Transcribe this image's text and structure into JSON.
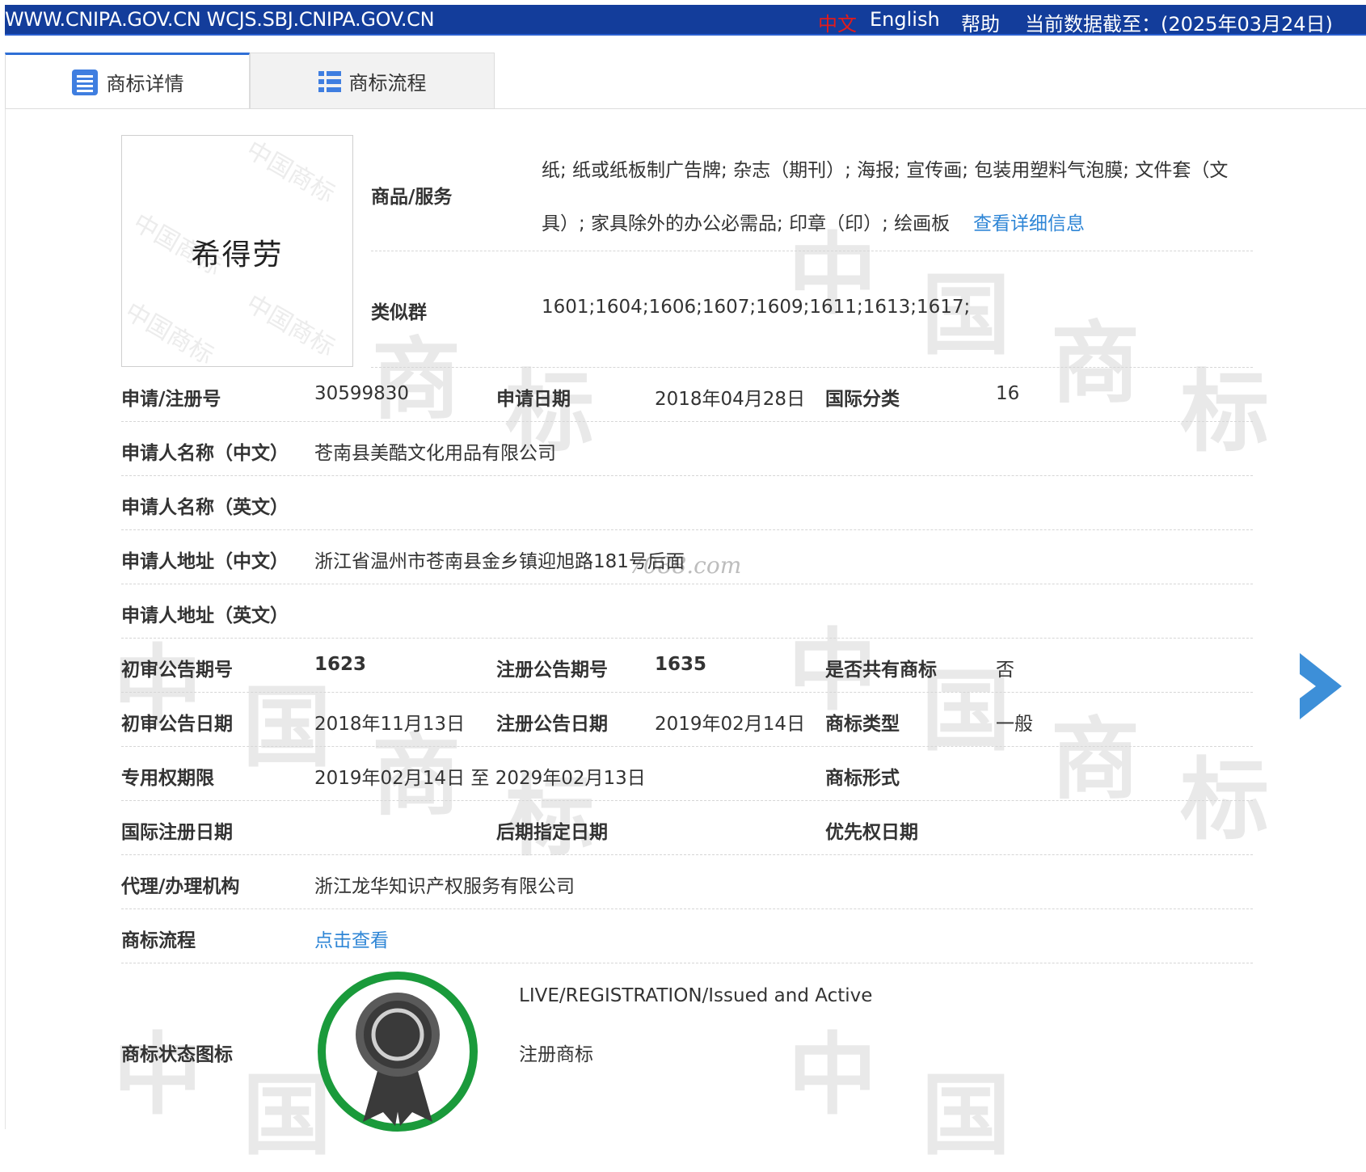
{
  "topbar": {
    "site": "WWW.CNIPA.GOV.CN WCJS.SBJ.CNIPA.GOV.CN",
    "lang_cn": "中文",
    "lang_en": "English",
    "help": "帮助",
    "data_date": "当前数据截至：(2025年03月24日)"
  },
  "tabs": [
    {
      "label": "商标详情",
      "active": true
    },
    {
      "label": "商标流程",
      "active": false
    }
  ],
  "watermark": {
    "char1": "中",
    "char2": "国",
    "char3": "商",
    "char4": "标",
    "site": "7088.com"
  },
  "mark_image": {
    "text": "希得劳",
    "stamp": "中国商标"
  },
  "goods": {
    "label": "商品/服务",
    "line1": "纸; 纸或纸板制广告牌; 杂志（期刊）; 海报; 宣传画; 包装用塑料气泡膜; 文件套（文",
    "line2": "具）; 家具除外的办公必需品; 印章（印）; 绘画板",
    "detail_link": "查看详细信息"
  },
  "similar_group": {
    "label": "类似群",
    "value": "1601;1604;1606;1607;1609;1611;1613;1617;"
  },
  "reg_no": {
    "label": "申请/注册号",
    "value": "30599830"
  },
  "apply_date": {
    "label": "申请日期",
    "value": "2018年04月28日"
  },
  "intl_class": {
    "label": "国际分类",
    "value": "16"
  },
  "applicant_cn": {
    "label": "申请人名称（中文）",
    "value": "苍南县美酷文化用品有限公司"
  },
  "applicant_en": {
    "label": "申请人名称（英文）",
    "value": ""
  },
  "address_cn": {
    "label": "申请人地址（中文）",
    "value": "浙江省温州市苍南县金乡镇迎旭路181号后面"
  },
  "address_en": {
    "label": "申请人地址（英文）",
    "value": ""
  },
  "prelim_issue": {
    "label": "初审公告期号",
    "value": "1623"
  },
  "reg_issue": {
    "label": "注册公告期号",
    "value": "1635"
  },
  "shared": {
    "label": "是否共有商标",
    "value": "否"
  },
  "prelim_date": {
    "label": "初审公告日期",
    "value": "2018年11月13日"
  },
  "reg_date": {
    "label": "注册公告日期",
    "value": "2019年02月14日"
  },
  "mark_type": {
    "label": "商标类型",
    "value": "一般"
  },
  "exclusive_period": {
    "label": "专用权期限",
    "value": "2019年02月14日 至 2029年02月13日"
  },
  "mark_form": {
    "label": "商标形式",
    "value": ""
  },
  "intl_reg_date": {
    "label": "国际注册日期",
    "value": ""
  },
  "later_designation": {
    "label": "后期指定日期",
    "value": ""
  },
  "priority_date": {
    "label": "优先权日期",
    "value": ""
  },
  "agency": {
    "label": "代理/办理机构",
    "value": "浙江龙华知识产权服务有限公司"
  },
  "process": {
    "label": "商标流程",
    "link": "点击查看"
  },
  "status": {
    "label": "商标状态图标",
    "en": "LIVE/REGISTRATION/Issued and Active",
    "cn": "注册商标"
  },
  "colors": {
    "topbar": "#133d9b",
    "link": "#2f86d6",
    "tab_accent": "#2f6fd6",
    "status_ring": "#1a9a3b",
    "arrow": "#3d8fd8"
  }
}
